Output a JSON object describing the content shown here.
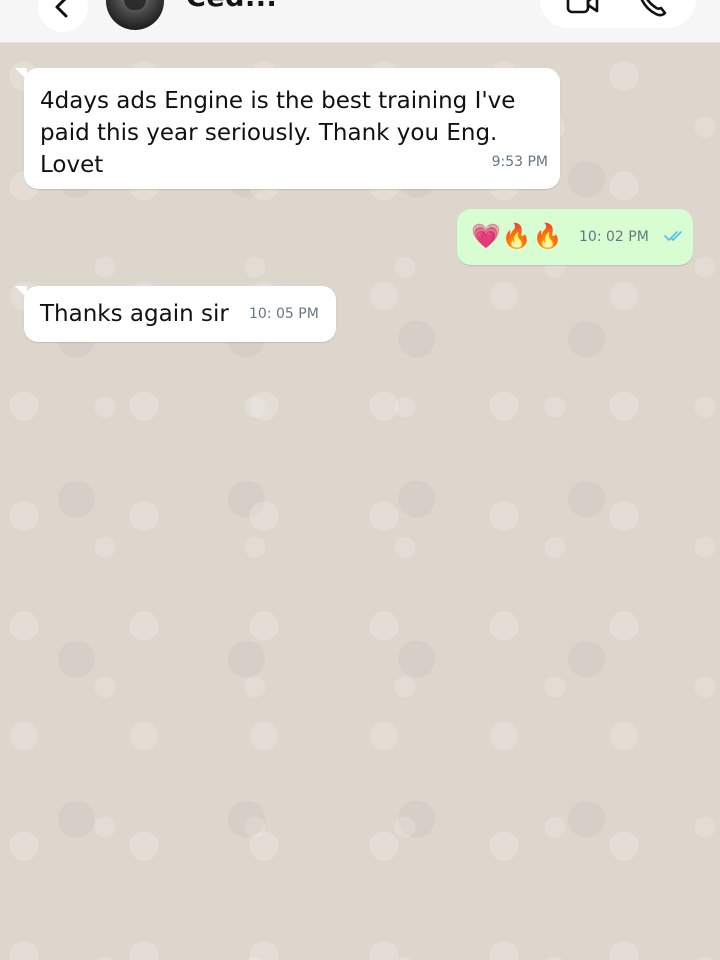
{
  "header": {
    "contact_name": "Ced...",
    "avatar_icon": "avatar-photo",
    "back_icon": "chevron-left-icon",
    "video_icon": "video-camera-icon",
    "phone_icon": "phone-icon"
  },
  "colors": {
    "chat_background": "#ddd6cd",
    "incoming_bubble": "#ffffff",
    "outgoing_bubble": "#d9fdd3",
    "read_ticks": "#53bdeb",
    "timestamp": "#667781"
  },
  "messages": [
    {
      "direction": "incoming",
      "text": "4days ads Engine is the best training I've paid this year seriously. Thank you Eng. Lovet",
      "time": "9:53 PM"
    },
    {
      "direction": "outgoing",
      "emoji": [
        "💗",
        "🔥",
        "🔥"
      ],
      "time": "10: 02 PM",
      "status": "read"
    },
    {
      "direction": "incoming",
      "text": "Thanks again sir",
      "time": "10: 05 PM"
    }
  ]
}
